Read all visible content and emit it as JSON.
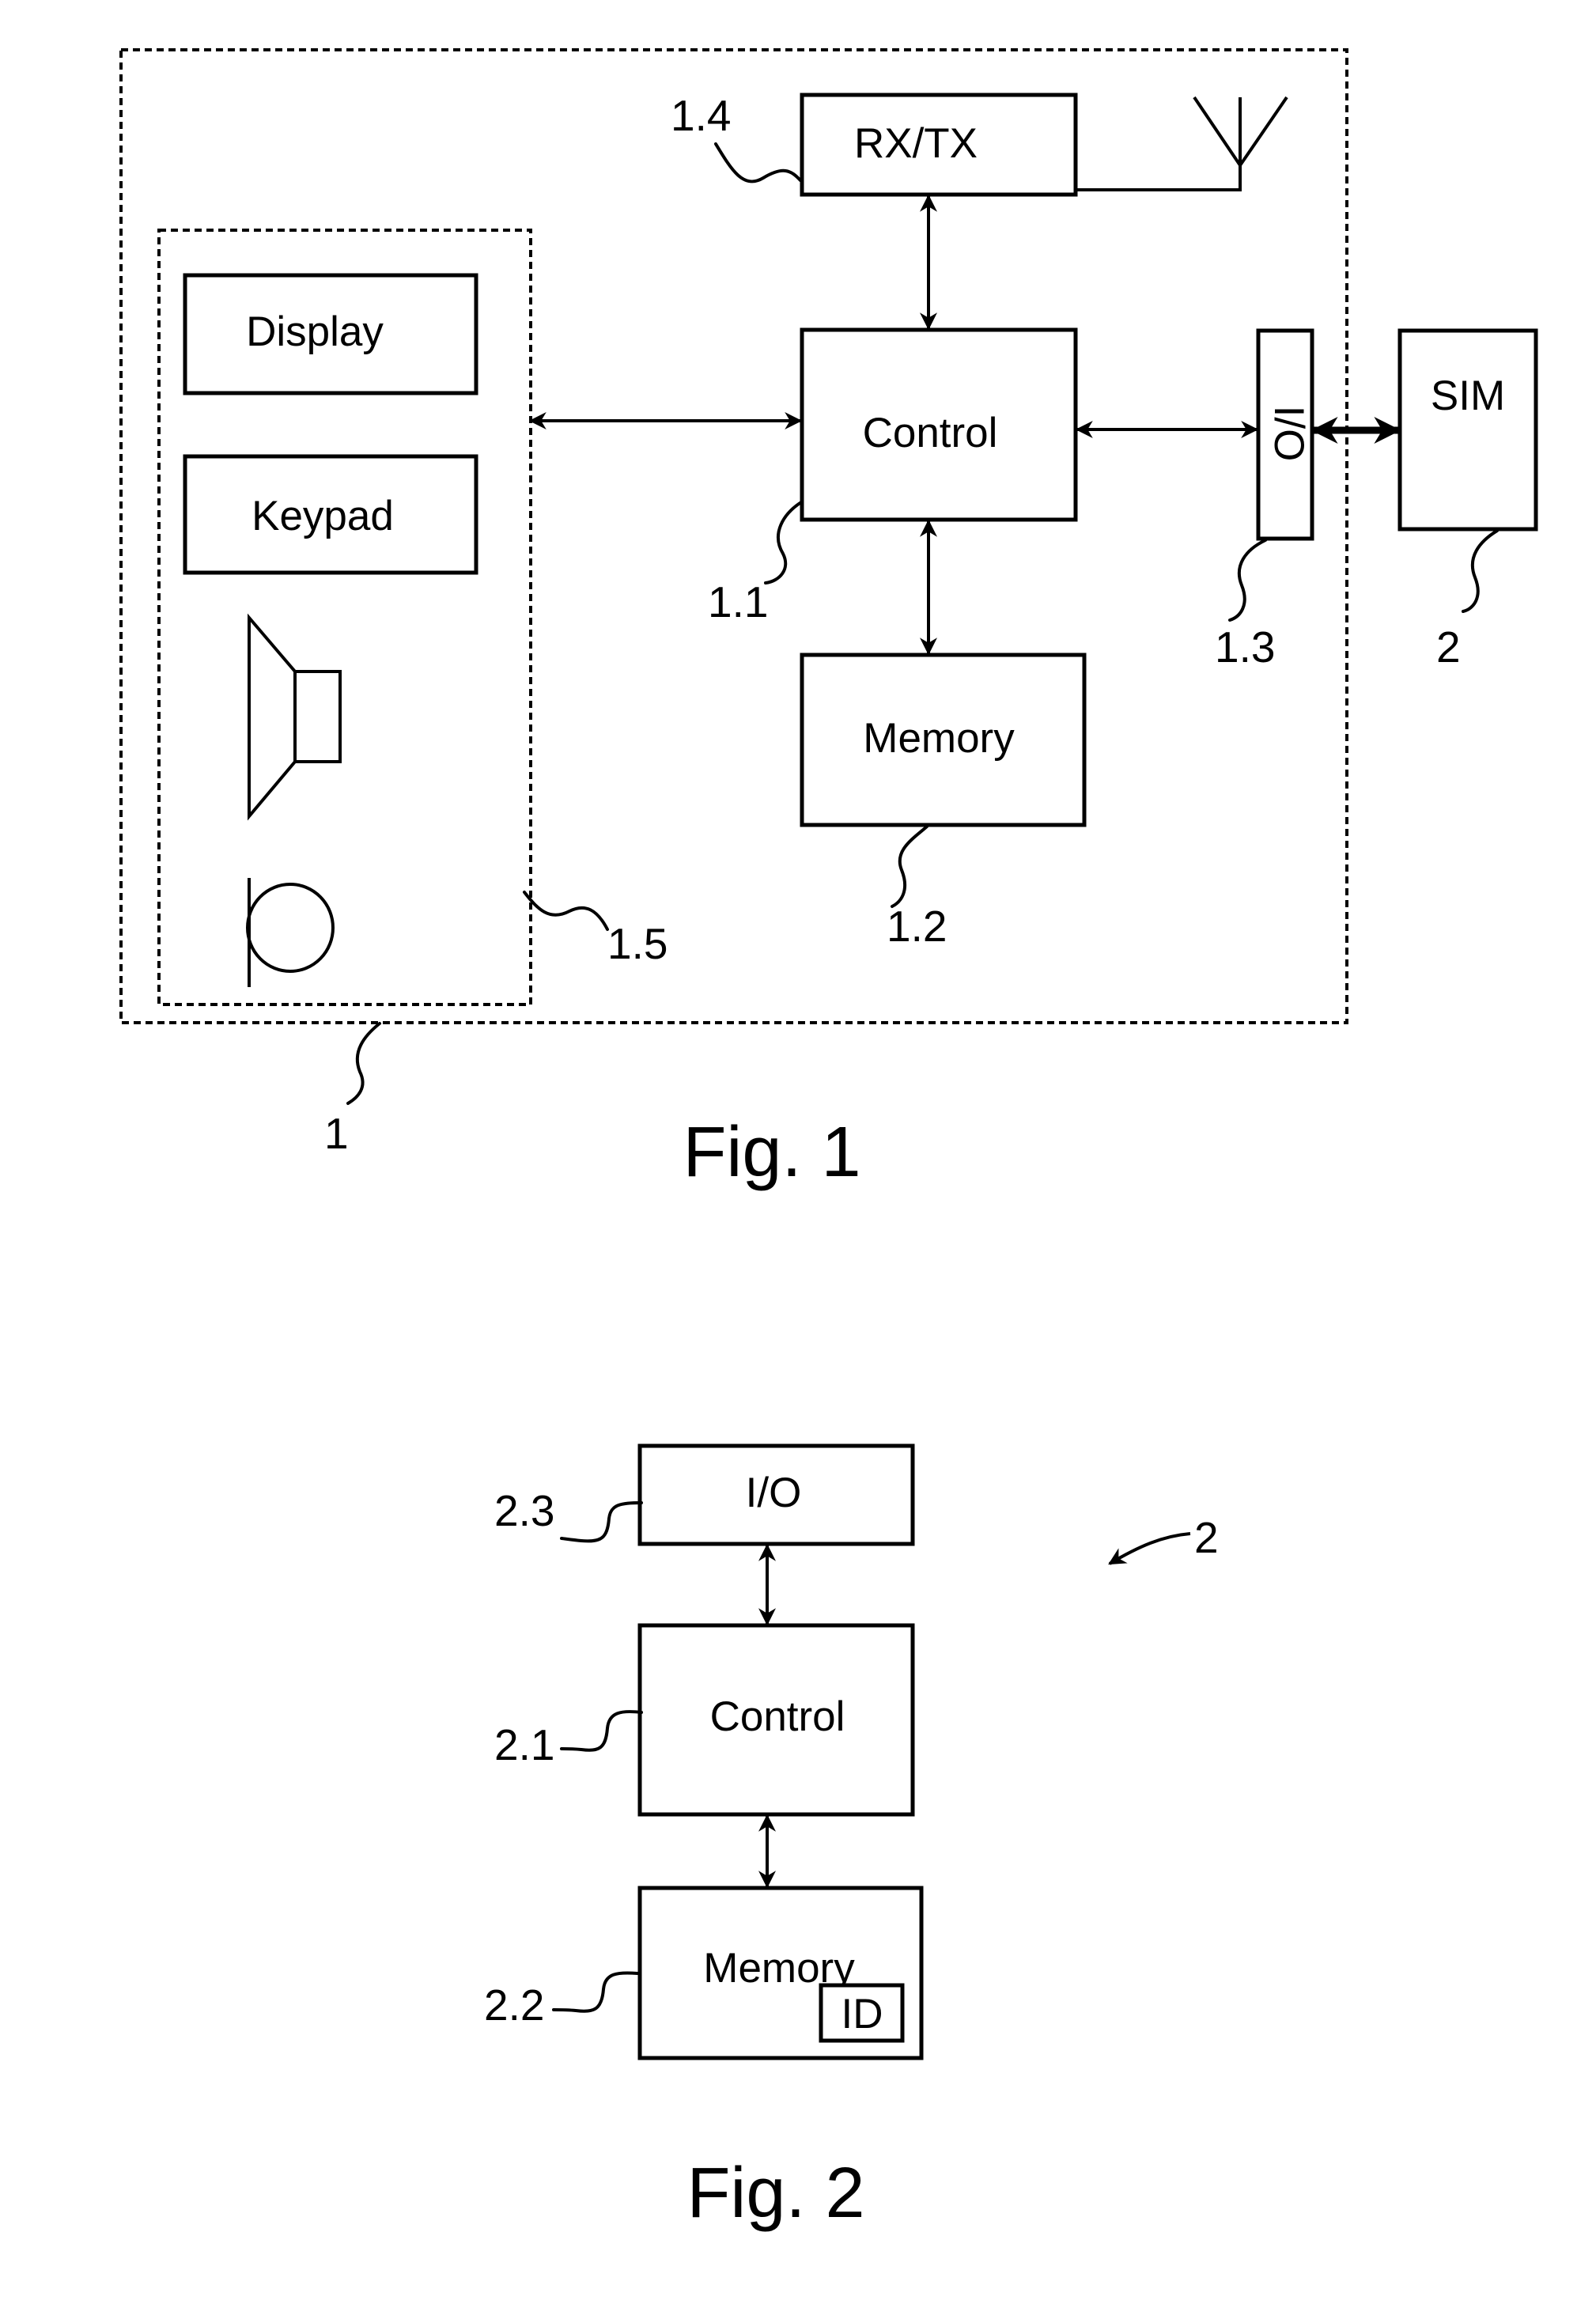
{
  "figures": [
    {
      "caption": "Fig. 1",
      "device": {
        "ref": "1",
        "ui_group_ref": "1.5",
        "blocks": {
          "display": "Display",
          "keypad": "Keypad",
          "rxtx": "RX/TX",
          "control": "Control",
          "memory": "Memory",
          "io": "I/O",
          "sim": "SIM"
        },
        "refs": {
          "rxtx": "1.4",
          "control": "1.1",
          "memory": "1.2",
          "io": "1.3",
          "sim": "2"
        },
        "icons": [
          "speaker-icon",
          "microphone-icon",
          "antenna-icon"
        ]
      }
    },
    {
      "caption": "Fig. 2",
      "sim_card": {
        "ref": "2",
        "blocks": {
          "io": "I/O",
          "control": "Control",
          "memory": "Memory",
          "id": "ID"
        },
        "refs": {
          "io": "2.3",
          "control": "2.1",
          "memory": "2.2"
        }
      }
    }
  ]
}
